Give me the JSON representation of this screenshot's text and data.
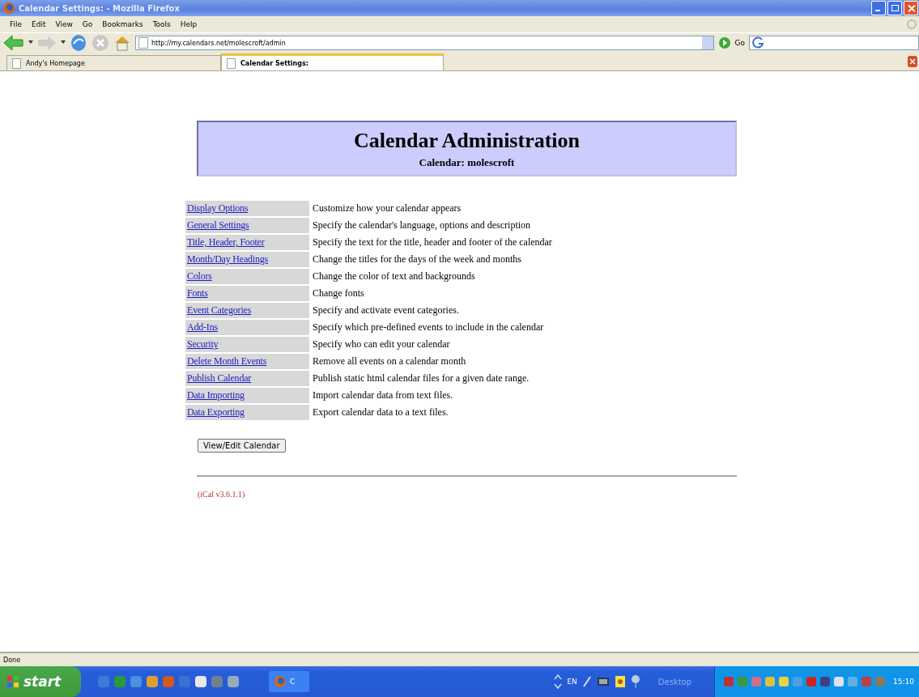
{
  "window": {
    "title": "Calendar Settings: - Mozilla Firefox"
  },
  "menu": [
    "File",
    "Edit",
    "View",
    "Go",
    "Bookmarks",
    "Tools",
    "Help"
  ],
  "address": {
    "value": "http://my.calendars.net/molescroft/admin"
  },
  "go_label": "Go",
  "tabs": [
    {
      "label": "Andy's Homepage",
      "selected": false
    },
    {
      "label": "Calendar Settings:",
      "selected": true
    }
  ],
  "header": {
    "title": "Calendar Administration",
    "subtitle": "Calendar: molescroft"
  },
  "options": [
    {
      "link": "Display Options",
      "description": "Customize how your calendar appears"
    },
    {
      "link": "General Settings",
      "description": "Specify the calendar's language, options and description"
    },
    {
      "link": "Title, Header, Footer",
      "description": "Specify the text for the title, header and footer of the calendar"
    },
    {
      "link": "Month/Day Headings",
      "description": "Change the titles for the days of the week and months"
    },
    {
      "link": "Colors",
      "description": "Change the color of text and backgrounds"
    },
    {
      "link": "Fonts",
      "description": "Change fonts"
    },
    {
      "link": "Event Categories",
      "description": "Specify and activate event categories."
    },
    {
      "link": "Add-Ins",
      "description": "Specify which pre-defined events to include in the calendar"
    },
    {
      "link": "Security",
      "description": "Specify who can edit your calendar"
    },
    {
      "link": "Delete Month Events",
      "description": "Remove all events on a calendar month"
    },
    {
      "link": "Publish Calendar",
      "description": "Publish static html calendar files for a given date range."
    },
    {
      "link": "Data Importing",
      "description": "Import calendar data from text files."
    },
    {
      "link": "Data Exporting",
      "description": "Export calendar data to a text files."
    }
  ],
  "button": "View/Edit Calendar",
  "version": "(iCal v3.6.1.1)",
  "status_bar": "Done",
  "taskbar": {
    "start": "start",
    "task": "C",
    "language": "EN",
    "toolbar": "Desktop",
    "clock": "15:10"
  }
}
